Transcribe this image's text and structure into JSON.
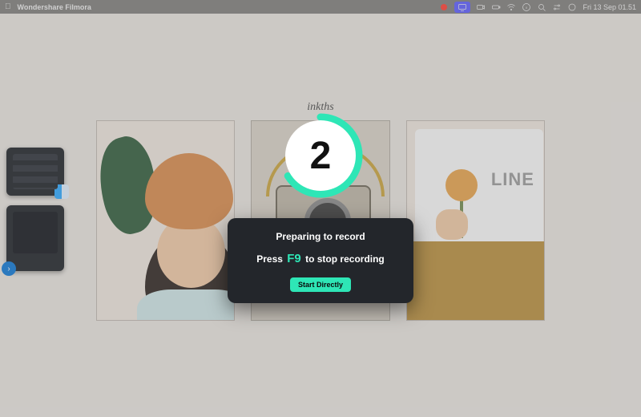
{
  "menubar": {
    "app_name": "Wondershare Filmora",
    "clock": "Fri 13 Sep  01.51"
  },
  "gallery": {
    "title": "inkths",
    "card3_text": "LINE"
  },
  "countdown": {
    "value": "2",
    "progress_pct": 66
  },
  "dialog": {
    "line1": "Preparing to record",
    "line2_pre": "Press ",
    "line2_key": "F9",
    "line2_post": " to stop recording",
    "button": "Start Directly"
  },
  "colors": {
    "accent": "#2ee6b6",
    "dialog_bg": "#23262b"
  }
}
